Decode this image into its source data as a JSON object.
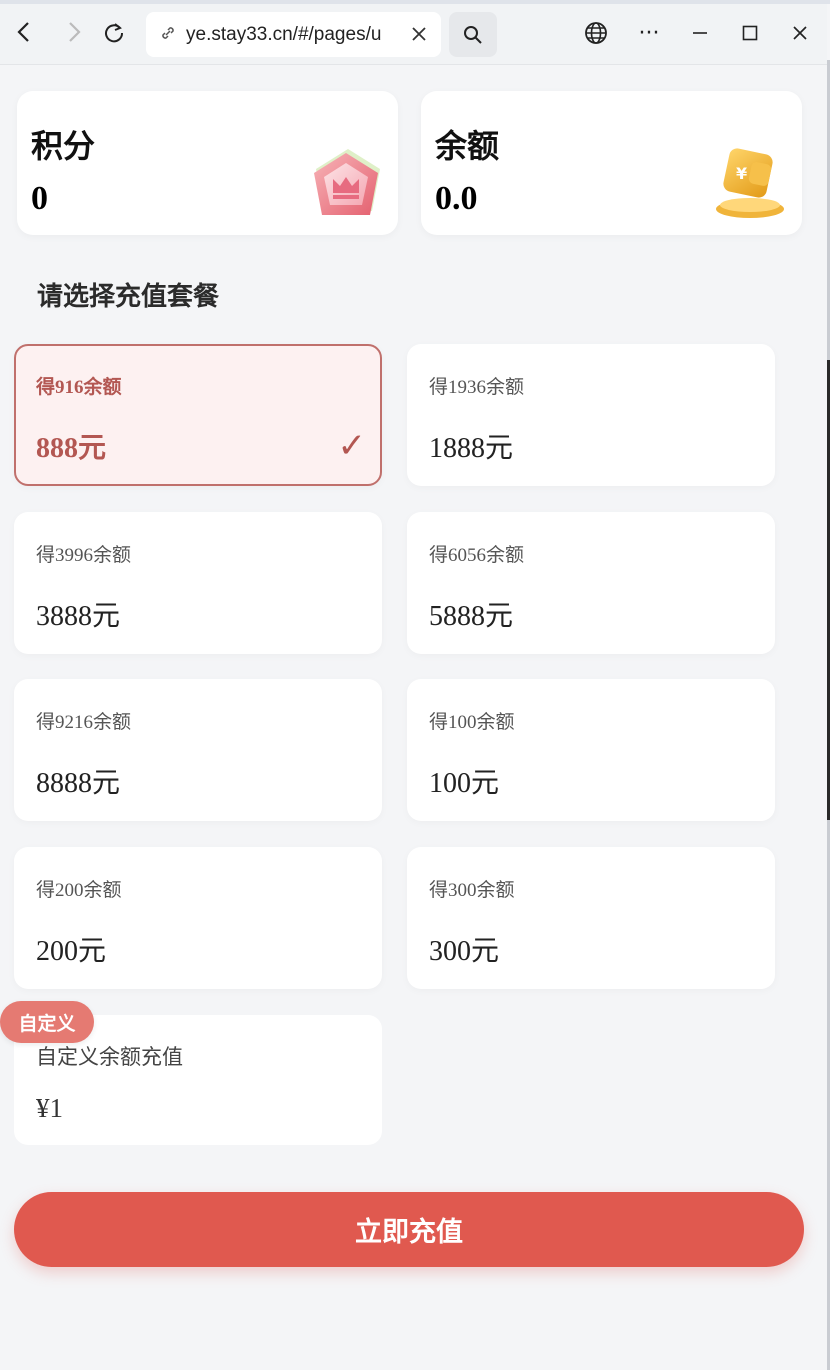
{
  "browser": {
    "url": "ye.stay33.cn/#/pages/u",
    "back_icon": "‹",
    "forward_icon": "›",
    "refresh_icon": "↻",
    "close_icon": "✕",
    "search_icon": "search",
    "globe_icon": "globe",
    "more_icon": "···",
    "minimize_icon": "—",
    "maximize_icon": "☐",
    "window_close_icon": "✕"
  },
  "summary": {
    "points_label": "积分",
    "points_value": "0",
    "balance_label": "余额",
    "balance_value": "0.0"
  },
  "section_title": "请选择充值套餐",
  "packages": [
    {
      "desc": "得916余额",
      "price": "888元",
      "selected": true
    },
    {
      "desc": "得1936余额",
      "price": "1888元",
      "selected": false
    },
    {
      "desc": "得3996余额",
      "price": "3888元",
      "selected": false
    },
    {
      "desc": "得6056余额",
      "price": "5888元",
      "selected": false
    },
    {
      "desc": "得9216余额",
      "price": "8888元",
      "selected": false
    },
    {
      "desc": "得100余额",
      "price": "100元",
      "selected": false
    },
    {
      "desc": "得200余额",
      "price": "200元",
      "selected": false
    },
    {
      "desc": "得300余额",
      "price": "300元",
      "selected": false
    }
  ],
  "check_mark": "✓",
  "custom": {
    "badge": "自定义",
    "desc": "自定义余额充值",
    "value": "¥1"
  },
  "submit_label": "立即充值",
  "colors": {
    "accent": "#e0594f",
    "selected_text": "#b35752",
    "selected_bg": "#fdf1f1",
    "badge": "#e57a72"
  }
}
